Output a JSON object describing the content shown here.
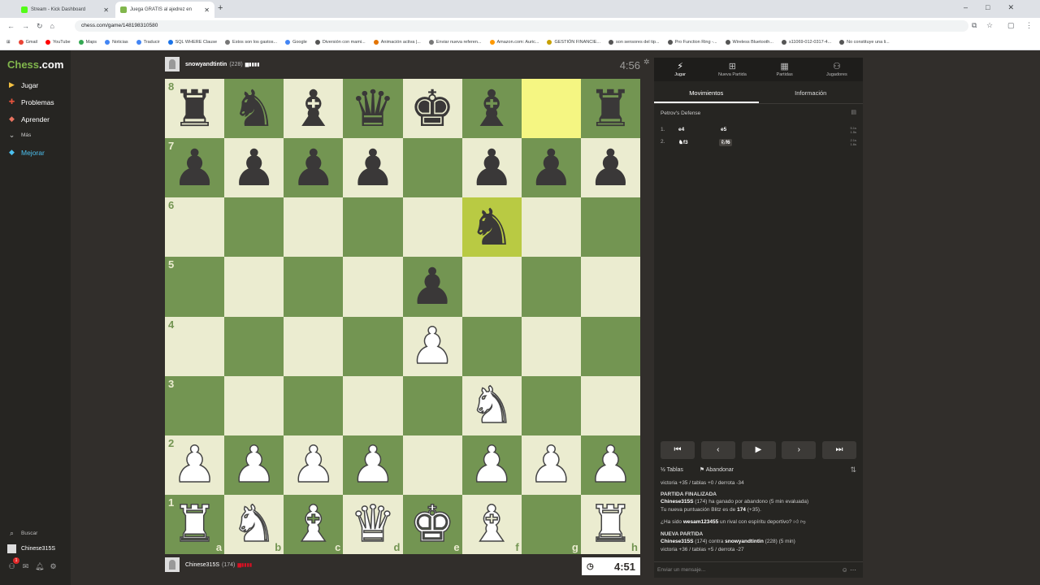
{
  "browser": {
    "tabs": [
      {
        "title": "Stream - Kick Dashboard",
        "color": "#53fc18"
      },
      {
        "title": "Juega GRATIS al ajedrez en",
        "color": "#81b64c"
      }
    ],
    "url": "chess.com/game/148198310580",
    "bookmarks": [
      "Gmail",
      "YouTube",
      "Maps",
      "Noticias",
      "Traducir",
      "SQL WHERE Clause",
      "Estos son los gastos...",
      "Google",
      "Diversión con mami...",
      "Animación activa |...",
      "Enviar nueva referen...",
      "Amazon.com: Auric...",
      "GESTIÓN FINANCIE...",
      "son sensores del tip...",
      "Pro Function Ring -...",
      "Wireless Bluetooth...",
      "s11069-012-0317-4...",
      "No constituye una li..."
    ]
  },
  "sidebar": {
    "logo_a": "Chess",
    "logo_b": ".com",
    "items": [
      {
        "label": "Jugar",
        "icon": "play-icon",
        "color": "#f5c242"
      },
      {
        "label": "Problemas",
        "icon": "puzzle-icon",
        "color": "#e5533d"
      },
      {
        "label": "Aprender",
        "icon": "learn-icon",
        "color": "#e8735f"
      },
      {
        "label": "Más",
        "icon": "chevron-down-icon",
        "color": "#ccc"
      },
      {
        "label": "Mejorar",
        "icon": "diamond-icon",
        "color": "#4cc1f0"
      }
    ],
    "search": "Buscar",
    "user": "Chinese315S",
    "notif_count": "1"
  },
  "game": {
    "top_player": {
      "name": "snowyandtintin",
      "rating": "(228)"
    },
    "bottom_player": {
      "name": "Chinese315S",
      "rating": "(174)"
    },
    "top_clock": "4:56",
    "bottom_clock": "4:51",
    "board": [
      [
        "r",
        "n",
        "b",
        "q",
        "k",
        "b",
        "",
        "r"
      ],
      [
        "p",
        "p",
        "p",
        "p",
        "",
        "p",
        "p",
        "p"
      ],
      [
        "",
        "",
        "",
        "",
        "",
        "n",
        "",
        ""
      ],
      [
        "",
        "",
        "",
        "",
        "p",
        "",
        "",
        ""
      ],
      [
        "",
        "",
        "",
        "",
        "P",
        "",
        "",
        ""
      ],
      [
        "",
        "",
        "",
        "",
        "",
        "N",
        "",
        ""
      ],
      [
        "P",
        "P",
        "P",
        "P",
        "",
        "P",
        "P",
        "P"
      ],
      [
        "R",
        "N",
        "B",
        "Q",
        "K",
        "B",
        "",
        "R"
      ]
    ],
    "highlights": [
      [
        0,
        6
      ],
      [
        2,
        5
      ]
    ],
    "ranks": [
      "8",
      "7",
      "6",
      "5",
      "4",
      "3",
      "2",
      "1"
    ],
    "files": [
      "a",
      "b",
      "c",
      "d",
      "e",
      "f",
      "g",
      "h"
    ]
  },
  "panel": {
    "top_tabs": [
      {
        "label": "Jugar",
        "icon": "bolt-icon"
      },
      {
        "label": "Nueva Partida",
        "icon": "plus-icon"
      },
      {
        "label": "Partidas",
        "icon": "games-icon"
      },
      {
        "label": "Jugadores",
        "icon": "players-icon"
      }
    ],
    "sub_tabs": [
      "Movimientos",
      "Información"
    ],
    "opening": "Petrov's Defense",
    "moves": [
      {
        "num": "1.",
        "white": "e4",
        "black": "e5",
        "t1": "5.1s",
        "t2": "1.5s"
      },
      {
        "num": "2.",
        "white": "♞f3",
        "black": "♘f6",
        "t1": "2.1s",
        "t2": "1.6s"
      }
    ],
    "actions": {
      "draw": "Tablas",
      "resign": "Abandonar"
    },
    "chat": {
      "l1": "victoria +35 / tablas +0 / derrota -34",
      "h1": "PARTIDA FINALIZADA",
      "l2a": "Chinese315S",
      "l2b": " (174) ha ganado por abandono (5 min evaluada)",
      "l3a": "Tu nueva puntuación Blitz es de ",
      "l3b": "174",
      "l3c": " (+35).",
      "l4a": "¿Ha sido ",
      "l4b": "wesam123455",
      "l4c": " un rival con espíritu deportivo?",
      "h2": "NUEVA PARTIDA",
      "l5a": "Chinese315S",
      "l5b": " (174) contra ",
      "l5c": "snowyandtintin",
      "l5d": " (228) (5 min)",
      "l6": "victoria +36 / tablas +5 / derrota -27"
    },
    "chat_placeholder": "Enviar un mensaje..."
  }
}
